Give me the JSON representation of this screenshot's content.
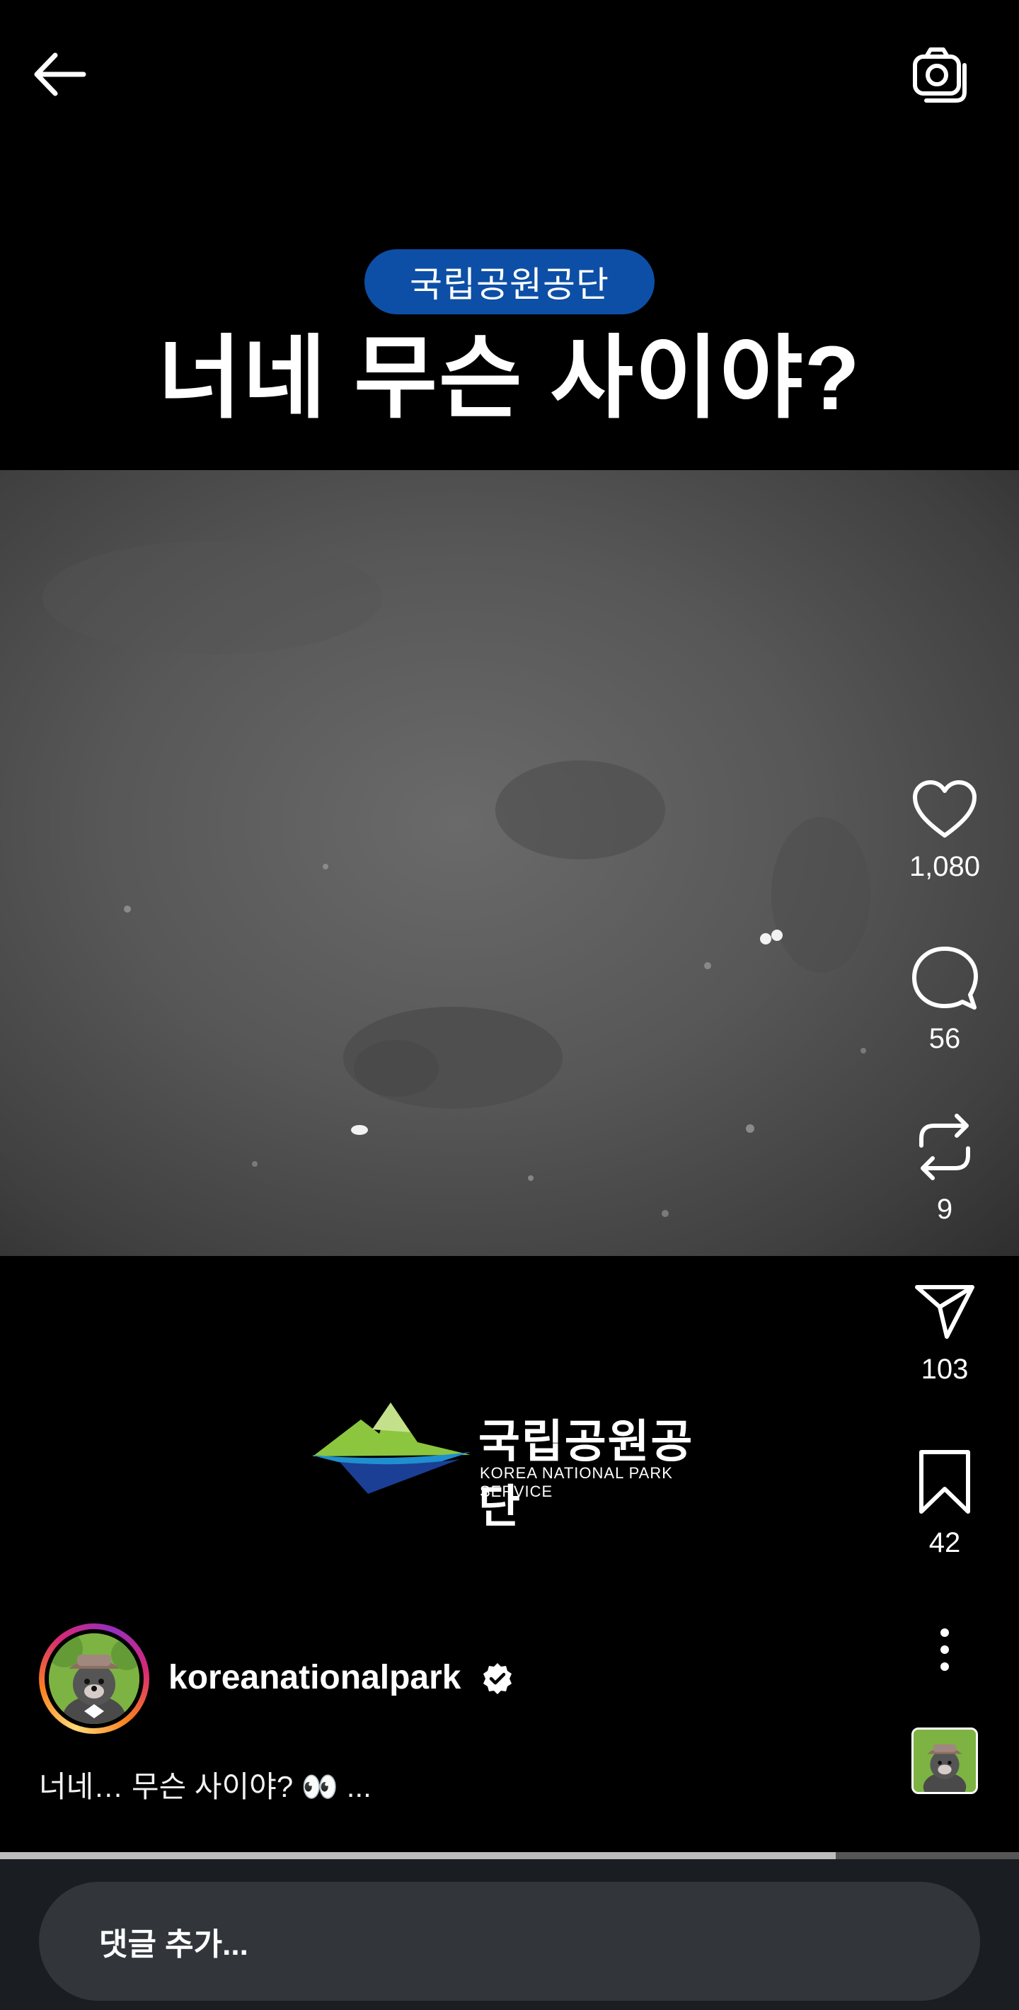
{
  "header": {
    "back_icon": "arrow-left-icon",
    "camera_icon": "camera-icon"
  },
  "video": {
    "badge": "국립공원공단",
    "headline": "너네 무슨 사이야?",
    "logo_ko": "국립공원공단",
    "logo_en": "KOREA NATIONAL PARK SERVICE"
  },
  "actions": {
    "like_count": "1,080",
    "comment_count": "56",
    "repost_count": "9",
    "share_count": "103",
    "save_count": "42"
  },
  "author": {
    "username": "koreanationalpark",
    "verified": true,
    "caption": "너네… 무슨 사이야? 👀 ..."
  },
  "playback": {
    "progress": 0.82
  },
  "comment": {
    "placeholder": "댓글 추가..."
  },
  "colors": {
    "badge_bg": "#0d4fa6",
    "bottom_bg": "#1a1d22",
    "input_bg": "#32363b"
  }
}
